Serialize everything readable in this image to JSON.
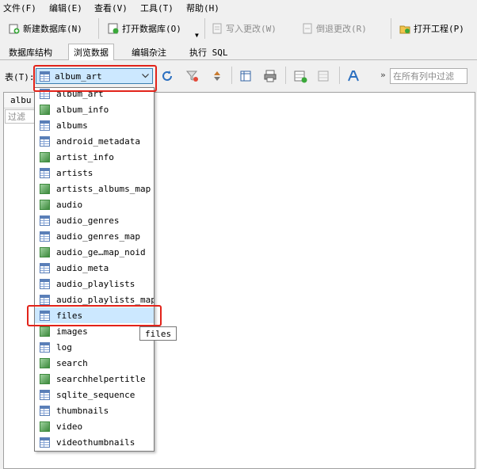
{
  "menubar": {
    "items": [
      "文件(F)",
      "编辑(E)",
      "查看(V)",
      "工具(T)",
      "帮助(H)"
    ]
  },
  "toolbar": {
    "new_db": "新建数据库(N)",
    "open_db": "打开数据库(O)",
    "write_changes": "写入更改(W)",
    "revert_changes": "倒退更改(R)",
    "open_project": "打开工程(P)"
  },
  "tabs": [
    "数据库结构",
    "浏览数据",
    "编辑杂注",
    "执行 SQL"
  ],
  "browse": {
    "table_label": "表(T):",
    "selected_table": "album_art",
    "filter_all_placeholder": "在所有列中过滤",
    "more": "»"
  },
  "grid": {
    "column_header": "albu",
    "filter_placeholder": "过滤"
  },
  "dropdown": {
    "items": [
      {
        "name": "album_art",
        "kind": "table-icon"
      },
      {
        "name": "album_info",
        "kind": "view-icon"
      },
      {
        "name": "albums",
        "kind": "table-icon"
      },
      {
        "name": "android_metadata",
        "kind": "table-icon"
      },
      {
        "name": "artist_info",
        "kind": "view-icon"
      },
      {
        "name": "artists",
        "kind": "table-icon"
      },
      {
        "name": "artists_albums_map",
        "kind": "view-icon"
      },
      {
        "name": "audio",
        "kind": "view-icon"
      },
      {
        "name": "audio_genres",
        "kind": "table-icon"
      },
      {
        "name": "audio_genres_map",
        "kind": "table-icon"
      },
      {
        "name": "audio_ge…map_noid",
        "kind": "view-icon"
      },
      {
        "name": "audio_meta",
        "kind": "table-icon"
      },
      {
        "name": "audio_playlists",
        "kind": "table-icon"
      },
      {
        "name": "audio_playlists_map",
        "kind": "table-icon"
      },
      {
        "name": "files",
        "kind": "table-icon"
      },
      {
        "name": "images",
        "kind": "view-icon"
      },
      {
        "name": "log",
        "kind": "table-icon"
      },
      {
        "name": "search",
        "kind": "view-icon"
      },
      {
        "name": "searchhelpertitle",
        "kind": "view-icon"
      },
      {
        "name": "sqlite_sequence",
        "kind": "table-icon"
      },
      {
        "name": "thumbnails",
        "kind": "table-icon"
      },
      {
        "name": "video",
        "kind": "view-icon"
      },
      {
        "name": "videothumbnails",
        "kind": "table-icon"
      }
    ],
    "highlighted": "files",
    "tooltip": "files"
  },
  "colors": {
    "highlight": "#cce8ff",
    "annotation_red": "#e2231a"
  }
}
